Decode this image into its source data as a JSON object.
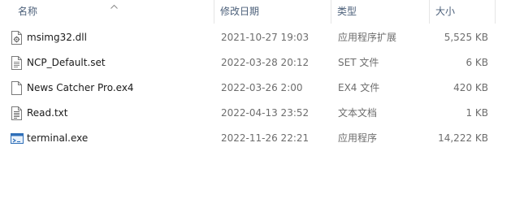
{
  "columns": {
    "name": "名称",
    "date": "修改日期",
    "type": "类型",
    "size": "大小"
  },
  "sort": {
    "column": "name",
    "direction": "ascending"
  },
  "files": [
    {
      "name": "msimg32.dll",
      "date": "2021-10-27 19:03",
      "type": "应用程序扩展",
      "size": "5,525 KB",
      "icon": "dll-file-icon"
    },
    {
      "name": "NCP_Default.set",
      "date": "2022-03-28 20:12",
      "type": "SET 文件",
      "size": "6 KB",
      "icon": "document-file-icon"
    },
    {
      "name": "News Catcher Pro.ex4",
      "date": "2022-03-26 2:00",
      "type": "EX4 文件",
      "size": "420 KB",
      "icon": "blank-file-icon"
    },
    {
      "name": "Read.txt",
      "date": "2022-04-13 23:52",
      "type": "文本文档",
      "size": "1 KB",
      "icon": "text-file-icon"
    },
    {
      "name": "terminal.exe",
      "date": "2022-11-26 22:21",
      "type": "应用程序",
      "size": "14,222 KB",
      "icon": "application-icon"
    }
  ],
  "colors": {
    "header_text": "#4c607a",
    "secondary_text": "#6d6d6d",
    "primary_text": "#1a1a1a",
    "app_icon_blue": "#2f6fb8"
  }
}
